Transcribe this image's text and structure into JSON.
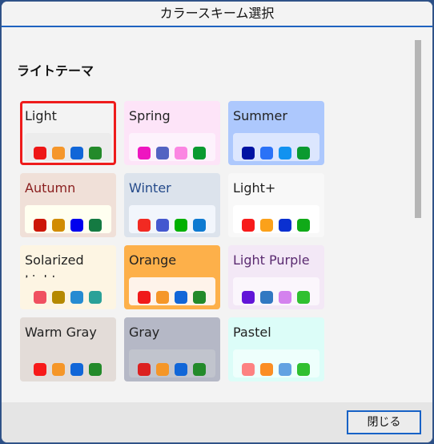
{
  "window": {
    "title": "カラースキーム選択"
  },
  "section": {
    "title": "ライトテーマ"
  },
  "themes": [
    {
      "name": "Light",
      "selected": true,
      "bg": "#f3f3f3",
      "panel": "#ececec",
      "text": "#222222",
      "swatches": [
        "#ee1616",
        "#f5962a",
        "#1166d8",
        "#238a2a"
      ]
    },
    {
      "name": "Spring",
      "selected": false,
      "bg": "#fde4f8",
      "panel": "#fdf2fc",
      "text": "#222222",
      "swatches": [
        "#ee16c0",
        "#5363c2",
        "#fb86e2",
        "#0a9a30"
      ]
    },
    {
      "name": "Summer",
      "selected": false,
      "bg": "#adc8fd",
      "panel": "#dce6fe",
      "text": "#222222",
      "swatches": [
        "#0012a2",
        "#2b72f7",
        "#1292f0",
        "#0a9a30"
      ]
    },
    {
      "name": "Autumn",
      "selected": false,
      "bg": "#f0e0d8",
      "panel": "#fffff0",
      "text": "#8a1e1e",
      "swatches": [
        "#cc1606",
        "#d18c00",
        "#0000ee",
        "#147a42"
      ]
    },
    {
      "name": "Winter",
      "selected": false,
      "bg": "#dce3ec",
      "panel": "#f2f6fc",
      "text": "#244a8a",
      "swatches": [
        "#f22a22",
        "#4458cf",
        "#00b000",
        "#0e7ad1"
      ]
    },
    {
      "name": "Light+",
      "selected": false,
      "bg": "#f8f8f8",
      "panel": "#ffffff",
      "text": "#222222",
      "swatches": [
        "#f71a1a",
        "#fba11a",
        "#0a30d0",
        "#10aa18"
      ]
    },
    {
      "name": "Solarized Light",
      "selected": false,
      "bg": "#fdf5e3",
      "panel": "#fdf5e3",
      "text": "#222222",
      "swatches": [
        "#f05060",
        "#b58900",
        "#268bd2",
        "#2aa198"
      ]
    },
    {
      "name": "Orange",
      "selected": false,
      "bg": "#fdb04a",
      "panel": "#fef3ea",
      "text": "#222222",
      "swatches": [
        "#f01a1a",
        "#f59628",
        "#1166d8",
        "#238a2a"
      ]
    },
    {
      "name": "Light Purple",
      "selected": false,
      "bg": "#f3e8f6",
      "panel": "#fbf6fc",
      "text": "#5a2a70",
      "swatches": [
        "#6214d8",
        "#3278c2",
        "#d482ee",
        "#30c030"
      ]
    },
    {
      "name": "Warm Gray",
      "selected": false,
      "bg": "#e3dcd8",
      "panel": "#e3dcd8",
      "text": "#222222",
      "swatches": [
        "#f71a1a",
        "#f59628",
        "#1166d8",
        "#238a2a"
      ]
    },
    {
      "name": "Gray",
      "selected": false,
      "bg": "#b5b8c6",
      "panel": "#c1c4cd",
      "text": "#222222",
      "swatches": [
        "#dc2020",
        "#f59628",
        "#1166d8",
        "#238a2a"
      ]
    },
    {
      "name": "Pastel",
      "selected": false,
      "bg": "#dcfdf8",
      "panel": "#eefffc",
      "text": "#222222",
      "swatches": [
        "#fd8282",
        "#fb8e24",
        "#62a2e2",
        "#30c030"
      ]
    }
  ],
  "footer": {
    "close_label": "閉じる"
  }
}
